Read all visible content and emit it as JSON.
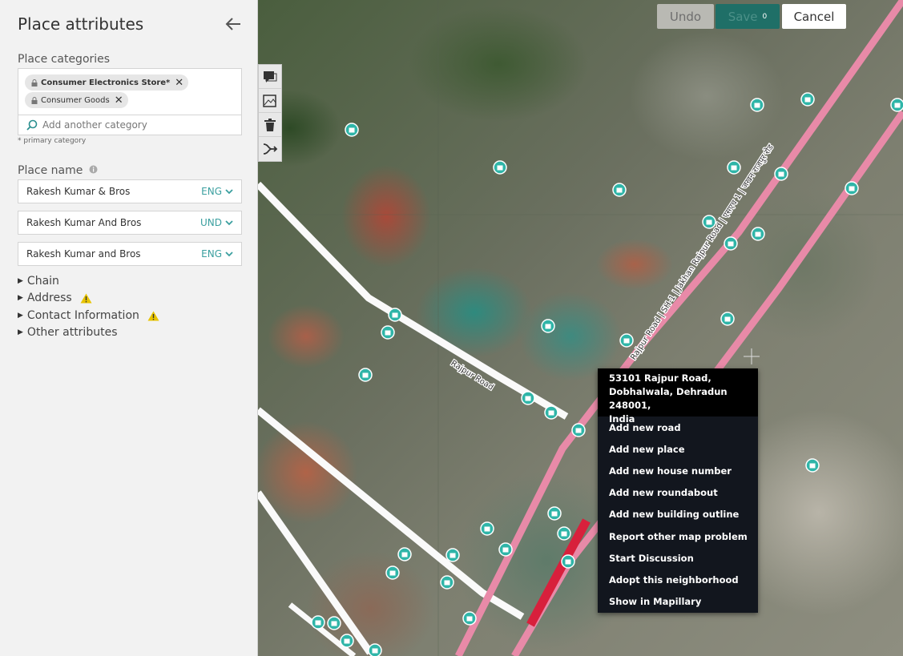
{
  "panel": {
    "title": "Place attributes",
    "categories_label": "Place categories",
    "categories": [
      {
        "label": "Consumer Electronics Store*",
        "primary": true
      },
      {
        "label": "Consumer Goods",
        "primary": false
      }
    ],
    "category_search_placeholder": "Add another category",
    "primary_note": "* primary category",
    "place_name_label": "Place name",
    "names": [
      {
        "value": "Rakesh Kumar & Bros",
        "lang": "ENG"
      },
      {
        "value": "Rakesh Kumar And Bros",
        "lang": "UND"
      },
      {
        "value": "Rakesh Kumar and Bros",
        "lang": "ENG"
      }
    ],
    "sections": [
      {
        "label": "Chain",
        "warning": false
      },
      {
        "label": "Address",
        "warning": true
      },
      {
        "label": "Contact Information",
        "warning": true
      },
      {
        "label": "Other attributes",
        "warning": false
      }
    ]
  },
  "toolbar": {
    "undo_label": "Undo",
    "save_label": "Save",
    "save_count": "0",
    "cancel_label": "Cancel"
  },
  "map": {
    "road_labels": [
      "Rajpur Road",
      "Rajpur Road | SH-1 | Jakhan Rajpur Road | एसएच 1 | जखन राजपुर रोड"
    ]
  },
  "context_menu": {
    "address_line1": "53101 Rajpur Road,",
    "address_line2": "Dobhalwala, Dehradun 248001,",
    "address_line3": "India",
    "items": [
      "Add new road",
      "Add new place",
      "Add new house number",
      "Add new roundabout",
      "Add new building outline",
      "Report other map problem",
      "Start Discussion",
      "Adopt this neighborhood",
      "Show in Mapillary"
    ]
  },
  "colors": {
    "accent": "#3a9f9f",
    "highway": "#e88aa8",
    "save_bg": "#1f6f67",
    "poi": "#2fb5a8"
  }
}
